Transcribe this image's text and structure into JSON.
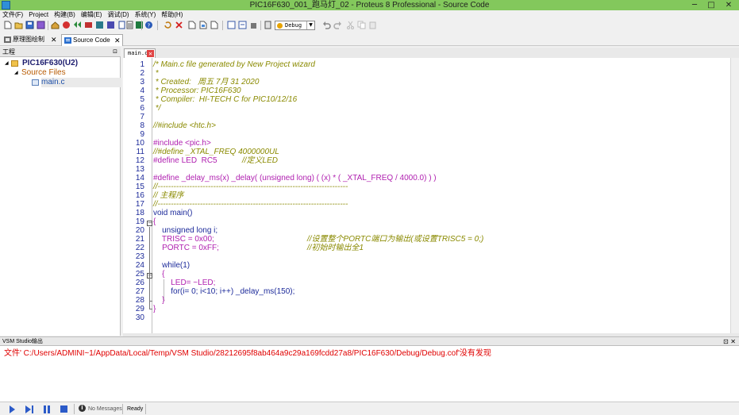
{
  "window": {
    "title": "PIC16F630_001_跑马灯_02 - Proteus 8 Professional - Source Code",
    "minimize": "─",
    "maximize": "□",
    "close": "✕"
  },
  "menu": [
    "文件(F)",
    "Project",
    "构建(B)",
    "编辑(E)",
    "调试(D)",
    "系统(Y)",
    "帮助(H)"
  ],
  "toolbar": {
    "build_config": "Debug"
  },
  "tabs": [
    {
      "label": "原理图绘制",
      "close": "✕"
    },
    {
      "label": "Source Code",
      "close": "✕"
    }
  ],
  "project": {
    "header": "工程",
    "pin": "⊡",
    "root": "PIC16F630(U2)",
    "folder": "Source Files",
    "file": "main.c",
    "expand_glyph": "◢"
  },
  "editor": {
    "file_tab": "main.c",
    "file_tab_close": "✕",
    "fold_open": "−",
    "lines": [
      {
        "n": "1",
        "t": "/* Main.c file generated by New Project wizard"
      },
      {
        "n": "2",
        "t": " *"
      },
      {
        "n": "3",
        "t": " * Created:   周五 7月 31 2020"
      },
      {
        "n": "4",
        "t": " * Processor: PIC16F630"
      },
      {
        "n": "5",
        "t": " * Compiler:  HI-TECH C for PIC10/12/16"
      },
      {
        "n": "6",
        "t": " */"
      },
      {
        "n": "7",
        "t": ""
      },
      {
        "n": "8",
        "t": "//#include <htc.h>"
      },
      {
        "n": "9",
        "t": ""
      },
      {
        "n": "10",
        "t": "#include <pic.h>"
      },
      {
        "n": "11",
        "t": "//#define _XTAL_FREQ 4000000UL"
      },
      {
        "n": "12a",
        "t": "#define LED  RC5"
      },
      {
        "n": "12b",
        "t": "//定义LED"
      },
      {
        "n": "13",
        "t": ""
      },
      {
        "n": "14",
        "t": "#define _delay_ms(x) _delay( (unsigned long) ( (x) * ( _XTAL_FREQ / 4000.0) ) )"
      },
      {
        "n": "15",
        "t": "//------------------------------------------------------------------------"
      },
      {
        "n": "16",
        "t": "// 主程序"
      },
      {
        "n": "17",
        "t": "//------------------------------------------------------------------------"
      },
      {
        "n": "18",
        "t": "void main()"
      },
      {
        "n": "19",
        "t": "{"
      },
      {
        "n": "20",
        "t": "    unsigned long i;"
      },
      {
        "n": "21a",
        "t": "    TRISC = 0x00;"
      },
      {
        "n": "21b",
        "t": "//设置整个PORTC端口为输出(或设置TRISC5 = 0;)"
      },
      {
        "n": "22a",
        "t": "    PORTC = 0xFF;"
      },
      {
        "n": "22b",
        "t": "//初始时输出全1"
      },
      {
        "n": "23",
        "t": ""
      },
      {
        "n": "24",
        "t": "    while(1)"
      },
      {
        "n": "25",
        "t": "    {"
      },
      {
        "n": "26",
        "t": "        LED= ~LED;"
      },
      {
        "n": "27",
        "t": "        for(i= 0; i<10; i++) _delay_ms(150);"
      },
      {
        "n": "28",
        "t": "    }"
      },
      {
        "n": "29",
        "t": "}"
      },
      {
        "n": "30",
        "t": ""
      }
    ],
    "line_numbers": [
      "1",
      "2",
      "3",
      "4",
      "5",
      "6",
      "7",
      "8",
      "9",
      "10",
      "11",
      "12",
      "13",
      "14",
      "15",
      "16",
      "17",
      "18",
      "19",
      "20",
      "21",
      "22",
      "23",
      "24",
      "25",
      "26",
      "27",
      "28",
      "29",
      "30"
    ]
  },
  "output": {
    "header": "VSM Studio输出",
    "buttons": "⊡ ✕",
    "message": "文件' C:/Users/ADMINI~1/AppData/Local/Temp/VSM Studio/28212695f8ab464a9c29a169fcdd27a8/PIC16F630/Debug/Debug.cof'没有发现"
  },
  "status": {
    "messages": "No Messages",
    "state": "Ready",
    "info_glyph": "i"
  },
  "colors": {
    "titlebar": "#83c85c",
    "comment": "#8a8a00",
    "preprocessor": "#b020b0",
    "keyword": "#1c2a9a",
    "error": "#e00000"
  }
}
